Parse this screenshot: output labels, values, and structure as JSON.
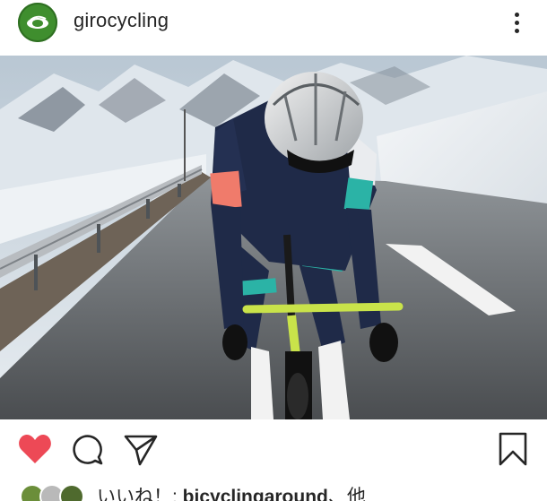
{
  "post": {
    "username": "girocycling",
    "likes_prefix": "いいね！: ",
    "likes_user": "bicyclingaround",
    "likes_suffix": "、他"
  },
  "icons": {
    "avatar": "giro-logo-icon",
    "more": "more-options-icon",
    "like": "heart-filled-icon",
    "comment": "comment-bubble-icon",
    "share": "paper-plane-icon",
    "save": "bookmark-icon"
  },
  "colors": {
    "like": "#ed4956",
    "brand_green": "#3f8e2e",
    "text": "#262626"
  }
}
